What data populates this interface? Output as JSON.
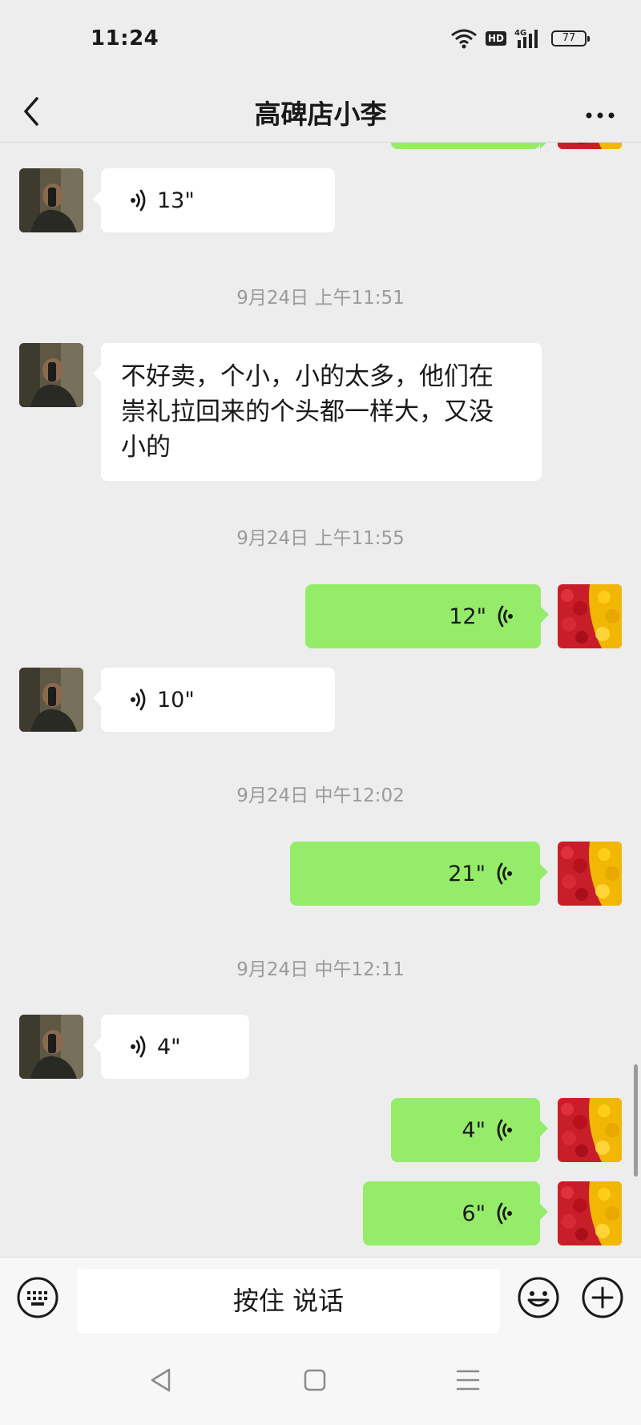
{
  "status_bar": {
    "time": "11:24",
    "hd": "HD",
    "network": "4G",
    "battery": "77"
  },
  "header": {
    "title": "高碑店小李"
  },
  "messages": [
    {
      "type": "voice",
      "direction": "in",
      "duration": "13\""
    },
    {
      "type": "timestamp",
      "text": "9月24日 上午11:51"
    },
    {
      "type": "text",
      "direction": "in",
      "lines": [
        "不好卖，个小，小的太多，他们在",
        "崇礼拉回来的个头都一样大，又没",
        "小的"
      ]
    },
    {
      "type": "timestamp",
      "text": "9月24日 上午11:55"
    },
    {
      "type": "voice",
      "direction": "out",
      "duration": "12\""
    },
    {
      "type": "voice",
      "direction": "in",
      "duration": "10\""
    },
    {
      "type": "timestamp",
      "text": "9月24日 中午12:02"
    },
    {
      "type": "voice",
      "direction": "out",
      "duration": "21\""
    },
    {
      "type": "timestamp",
      "text": "9月24日 中午12:11"
    },
    {
      "type": "voice",
      "direction": "in",
      "duration": "4\""
    },
    {
      "type": "voice",
      "direction": "out",
      "duration": "4\""
    },
    {
      "type": "voice",
      "direction": "out",
      "duration": "6\""
    }
  ],
  "input_bar": {
    "hold_to_talk": "按住 说话"
  },
  "icons": [
    "back-icon",
    "more-icon",
    "keyboard-icon",
    "emoji-icon",
    "plus-icon",
    "voice-icon"
  ],
  "colors": {
    "background": "#ededed",
    "outgoing_bubble": "#95ec69",
    "incoming_bubble": "#ffffff",
    "timestamp_text": "#9a9a9a"
  }
}
